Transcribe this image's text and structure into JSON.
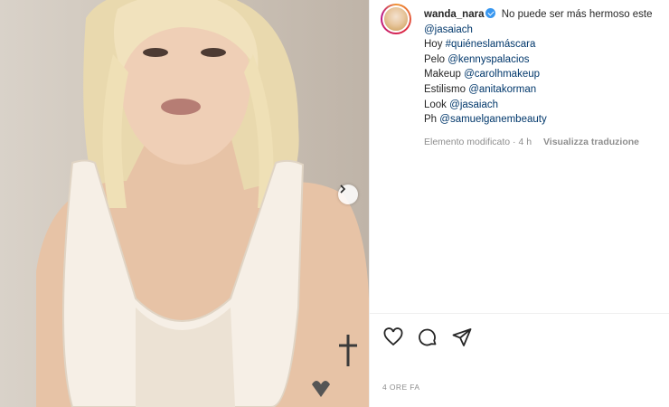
{
  "post": {
    "username": "wanda_nara",
    "caption_lines": [
      "No puede ser más hermoso este",
      "@jasaiach",
      "Hoy #quiéneslamáscara",
      "Pelo @kennyspalacios",
      "Makeup @carolhmakeup",
      "Estilismo @anitakorman",
      "Look @jasaiach",
      "Ph @samuelganembeauty"
    ],
    "caption_parts": {
      "hoy": "Hoy ",
      "hoy_tag": "#quiéneslamáscara",
      "pelo": "Pelo ",
      "pelo_tag": "@kennyspalacios",
      "makeup": "Makeup ",
      "makeup_tag": "@carolhmakeup",
      "estilismo": "Estilismo ",
      "estilismo_tag": "@anitakorman",
      "look": "Look ",
      "look_tag": "@jasaiach",
      "ph": "Ph ",
      "ph_tag": "@samuelganembeauty"
    },
    "edited_label": "Elemento modificato · 4 h",
    "translate_label": "Visualizza traduzione",
    "timestamp": "4 ORE FA"
  },
  "icons": {
    "like": "heart-icon",
    "comment": "comment-icon",
    "share": "send-icon",
    "next": "chevron-right-icon"
  },
  "colors": {
    "link": "#00376b",
    "muted": "#8e8e8e",
    "verified": "#3897f0"
  }
}
